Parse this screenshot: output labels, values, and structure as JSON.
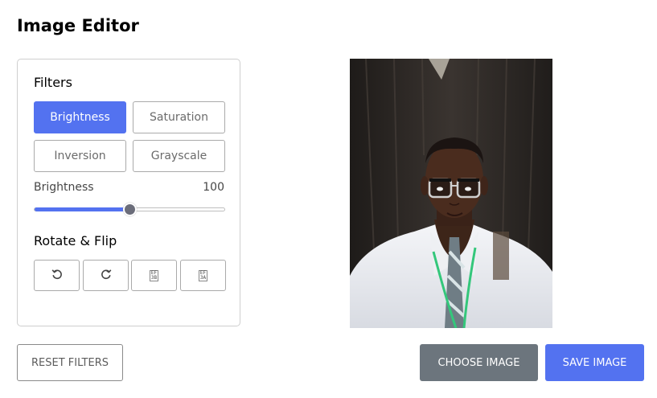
{
  "title": "Image Editor",
  "filters": {
    "heading": "Filters",
    "buttons": [
      {
        "label": "Brightness",
        "active": true
      },
      {
        "label": "Saturation",
        "active": false
      },
      {
        "label": "Inversion",
        "active": false
      },
      {
        "label": "Grayscale",
        "active": false
      }
    ],
    "slider": {
      "label": "Brightness",
      "value": "100",
      "fraction": 0.5
    }
  },
  "rotate": {
    "heading": "Rotate & Flip",
    "buttons": [
      {
        "icon": "rotate-left-icon"
      },
      {
        "icon": "rotate-right-icon"
      },
      {
        "icon": "flip-horizontal-icon",
        "glyph_top": "EF",
        "glyph_bottom": "3B"
      },
      {
        "icon": "flip-vertical-icon",
        "glyph_top": "EF",
        "glyph_bottom": "3A"
      }
    ]
  },
  "actions": {
    "reset_label": "RESET FILTERS",
    "choose_label": "CHOOSE IMAGE",
    "save_label": "SAVE IMAGE"
  },
  "colors": {
    "accent": "#5372f0",
    "choose_bg": "#6c757d"
  }
}
